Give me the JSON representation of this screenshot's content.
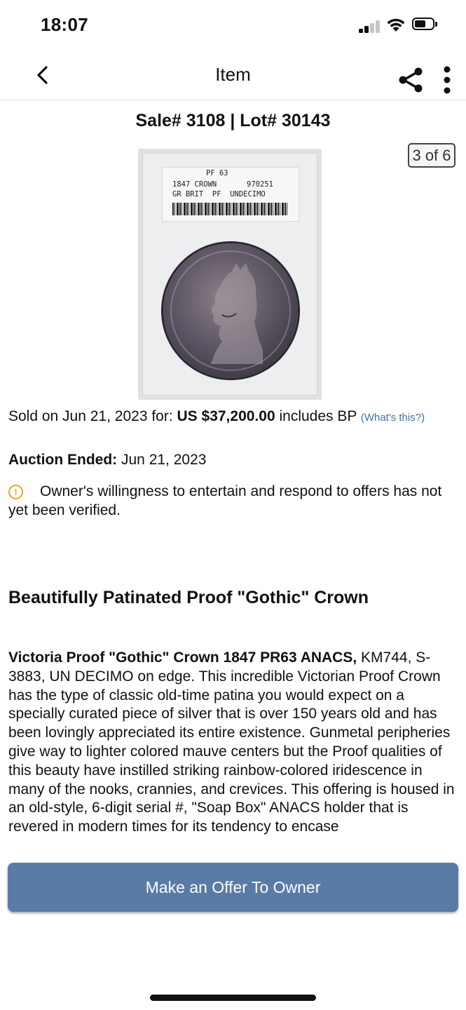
{
  "status_bar": {
    "time": "18:07"
  },
  "nav": {
    "title": "Item"
  },
  "item": {
    "sale_lot": "Sale# 3108 | Lot# 30143",
    "page_counter": "3 of 6",
    "slab": {
      "grade": "PF 63",
      "line1": "1847 CROWN",
      "code": "970251",
      "line2": "GR BRIT  PF  UNDECIMO"
    },
    "sold_prefix": "Sold on Jun 21, 2023 for:",
    "price": "US $37,200.00",
    "price_suffix": "includes BP",
    "whats_this": "(What's this?)",
    "auction_ended_label": "Auction Ended:",
    "auction_ended_date": "Jun 21, 2023",
    "owner_note": "Owner's willingness to entertain and respond to offers has not yet been verified.",
    "title": "Beautifully Patinated Proof \"Gothic\" Crown",
    "description_bold": "Victoria Proof \"Gothic\" Crown 1847 PR63 ANACS,",
    "description_text": "KM744, S-3883, UN DECIMO on edge. This incredible Victorian Proof Crown has the type of classic old-time patina you would expect on a specially curated piece of silver that is over 150 years old and has been lovingly appreciated its entire existence. Gunmetal peripheries give way to lighter colored mauve centers but the Proof qualities of this beauty have instilled striking rainbow-colored iridescence in many of the nooks, crannies, and crevices. This offering is housed in an old-style, 6-digit serial #, \"Soap Box\" ANACS holder that is revered in modern times for its tendency to encase"
  },
  "actions": {
    "offer_button": "Make an Offer To Owner"
  },
  "colors": {
    "accent": "#5a7ba6",
    "link": "#3f6fa3",
    "warning": "#f0a020"
  },
  "icons": [
    "back-chevron-icon",
    "share-icon",
    "more-vertical-icon",
    "warning-circle-icon"
  ]
}
